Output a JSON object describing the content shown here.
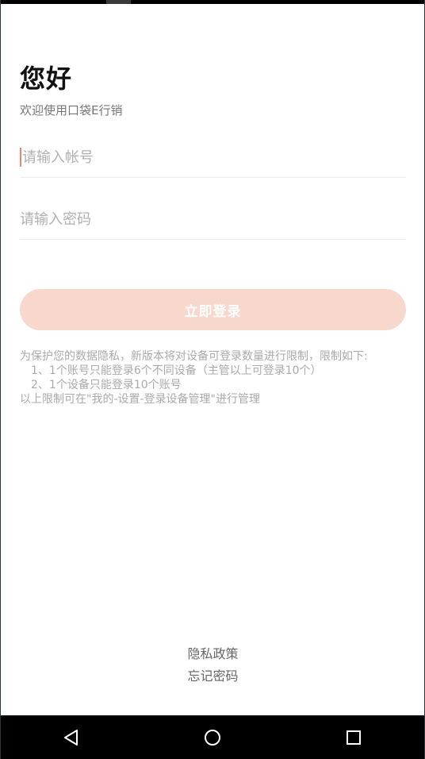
{
  "header": {
    "greeting": "您好",
    "subtitle": "欢迎使用口袋E行销"
  },
  "form": {
    "account_placeholder": "请输入帐号",
    "account_value": "",
    "password_placeholder": "请输入密码",
    "password_value": "",
    "login_label": "立即登录"
  },
  "notice": {
    "lines": [
      "为保护您的数据隐私，新版本将对设备可登录数量进行限制，限制如下:",
      "1、1个账号只能登录6个不同设备（主管以上可登录10个）",
      "2、1个设备只能登录10个账号",
      "以上限制可在\"我的-设置-登录设备管理\"进行管理"
    ]
  },
  "footer": {
    "privacy_label": "隐私政策",
    "forgot_label": "忘记密码"
  },
  "navbar": {
    "icons": [
      "back-icon",
      "home-icon",
      "recents-icon"
    ]
  },
  "colors": {
    "accent_caret": "#e2896a",
    "button_bg": "#f8d7cc",
    "nav_bg": "#000000"
  }
}
